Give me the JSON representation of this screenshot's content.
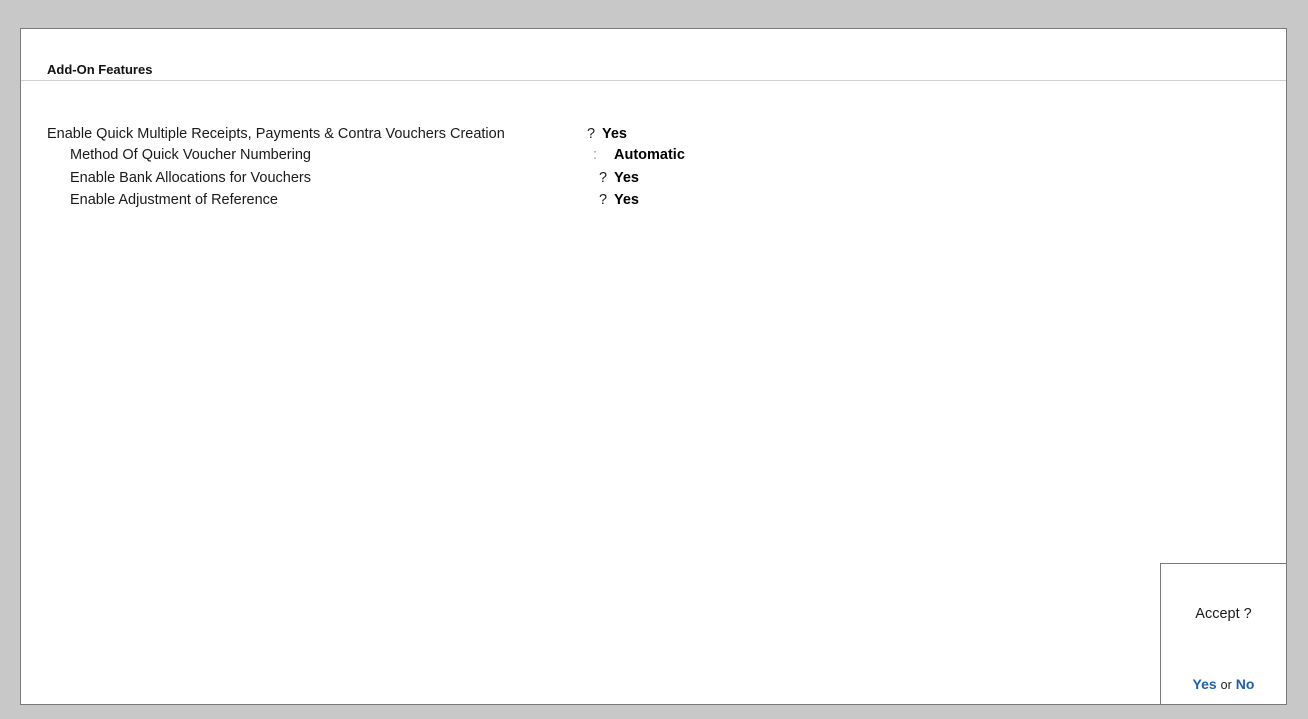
{
  "section": {
    "title": "Add-On Features"
  },
  "fields": [
    {
      "label": "Enable Quick Multiple Receipts, Payments & Contra Vouchers Creation",
      "separator": "?",
      "value": "Yes"
    },
    {
      "label": "Method Of Quick Voucher Numbering",
      "separator": ":",
      "value": "Automatic"
    },
    {
      "label": "Enable Bank Allocations for Vouchers",
      "separator": "?",
      "value": "Yes"
    },
    {
      "label": "Enable Adjustment of Reference",
      "separator": "?",
      "value": "Yes"
    }
  ],
  "accept_dialog": {
    "question": "Accept ?",
    "yes_label": "Yes",
    "or_label": "or",
    "no_label": "No"
  },
  "colors": {
    "option_accent": "#1f5fae",
    "background": "#c8c8c8"
  }
}
